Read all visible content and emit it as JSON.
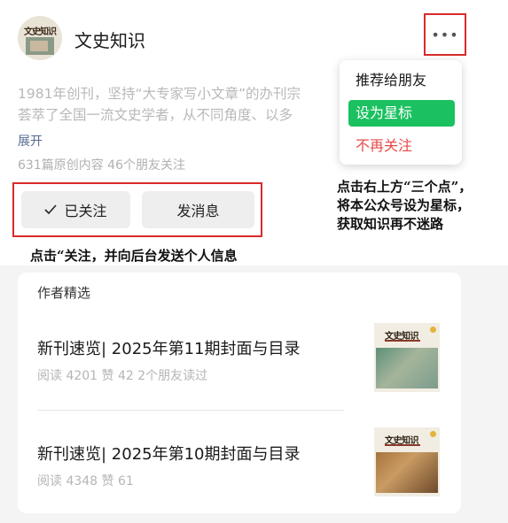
{
  "account": {
    "name": "文史知识",
    "avatar_text": "文史知识",
    "intro_line1": "1981年创刊，坚持“大专家写小文章”的办刊宗",
    "intro_line2": "荟萃了全国一流文史学者，从不同角度、以多",
    "expand_label": "展开",
    "stats": "631篇原创内容   46个朋友关注"
  },
  "more_icon": "ellipsis-icon",
  "buttons": {
    "followed_label": "已关注",
    "message_label": "发消息"
  },
  "menu": {
    "items": [
      "推荐给朋友",
      "设为星标",
      "不再关注"
    ]
  },
  "annotations": {
    "right_line1": "点击右上方“三个点”，",
    "right_line2": "将本公众号设为星标，",
    "right_line3": "获取知识再不迷路",
    "left": "点击“关注，并向后台发送个人信息"
  },
  "featured": {
    "section_title": "作者精选",
    "articles": [
      {
        "title": "新刊速览| 2025年第11期封面与目录",
        "meta": "阅读 4201  赞 42  2个朋友读过",
        "thumb_title": "文史知识"
      },
      {
        "title": "新刊速览| 2025年第10期封面与目录",
        "meta": "阅读 4348  赞 61",
        "thumb_title": "文史知识"
      }
    ]
  },
  "colors": {
    "annotation_border": "#d92b2b",
    "star_green": "#1bc160",
    "unfollow_red": "#e84a4a",
    "link_blue": "#576b95"
  }
}
